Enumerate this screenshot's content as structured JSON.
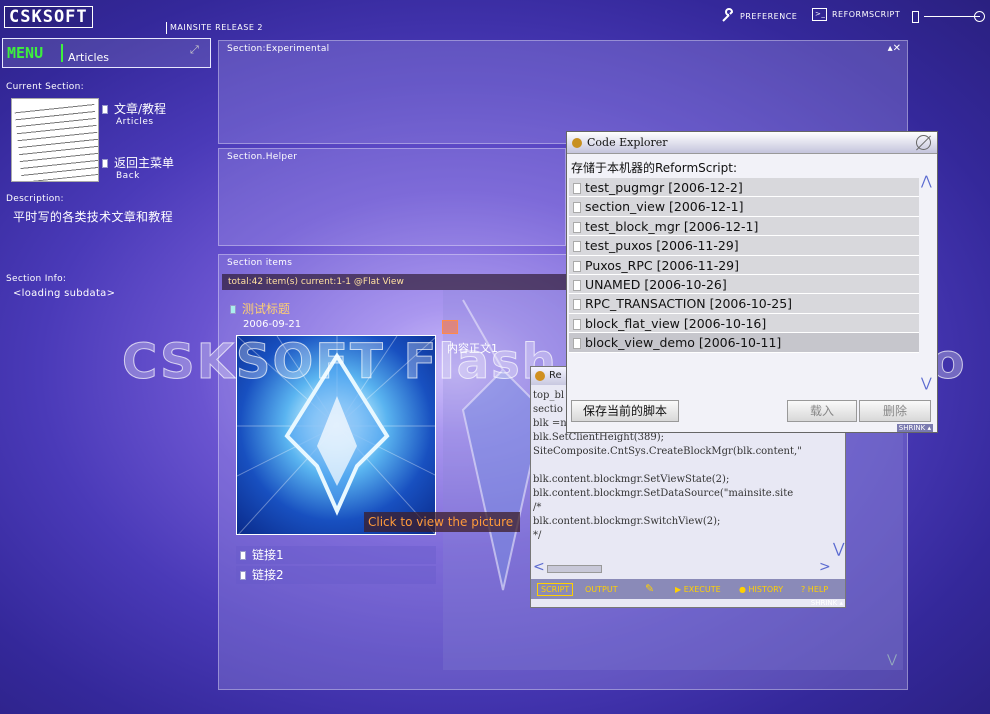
{
  "header": {
    "logo": "CSKSOFT",
    "release": "MAINSITE RELEASE 2",
    "preference_label": "PREFERENCE",
    "reformscript_label": "REFORMSCRIPT"
  },
  "menu": {
    "menu_label": "MENU",
    "section_label": "Articles"
  },
  "sidebar": {
    "current_section_label": "Current Section:",
    "links": [
      {
        "label": "文章/教程",
        "sub": "Articles"
      },
      {
        "label": "返回主菜单",
        "sub": "Back"
      }
    ],
    "description_label": "Description:",
    "description": "平时写的各类技术文章和教程",
    "section_info_label": "Section Info:",
    "section_info": "<loading subdata>"
  },
  "panels": {
    "experimental": "Section:Experimental",
    "helper": "Section.Helper",
    "items": "Section items",
    "status": "total:42 item(s) current:1-1 @Flat View"
  },
  "item": {
    "title": "测试标题",
    "date": "2006-09-21",
    "view_picture": "Click to view the picture",
    "body": "内容正文1",
    "links": [
      "链接1",
      "链接2"
    ]
  },
  "watermark": "CSKSOFT Flash Site V2 Demo",
  "editor": {
    "title": "Re",
    "code": "top_bl\nsectio\nblk =n\nblk.SetClientHeight(389);\nSiteComposite.CntSys.CreateBlockMgr(blk.content,\"\n\nblk.content.blockmgr.SetViewState(2);\nblk.content.blockmgr.SetDataSource(\"mainsite.site\n/*\nblk.content.blockmgr.SwitchView(2);\n*/",
    "tab_script": "SCRIPT",
    "tab_output": "OUTPUT",
    "execute": "EXECUTE",
    "history": "HISTORY",
    "help": "HELP",
    "shrink": "SHRINK"
  },
  "explorer": {
    "title": "Code Explorer",
    "label": "存储于本机器的ReformScript:",
    "scripts": [
      "test_pugmgr [2006-12-2]",
      "section_view [2006-12-1]",
      "test_block_mgr [2006-12-1]",
      "test_puxos [2006-11-29]",
      "Puxos_RPC [2006-11-29]",
      "UNAMED [2006-10-26]",
      "RPC_TRANSACTION [2006-10-25]",
      "block_flat_view [2006-10-16]",
      "block_view_demo [2006-10-11]"
    ],
    "save_button": "保存当前的脚本",
    "load_button": "载入",
    "delete_button": "删除",
    "shrink": "SHRINK"
  }
}
